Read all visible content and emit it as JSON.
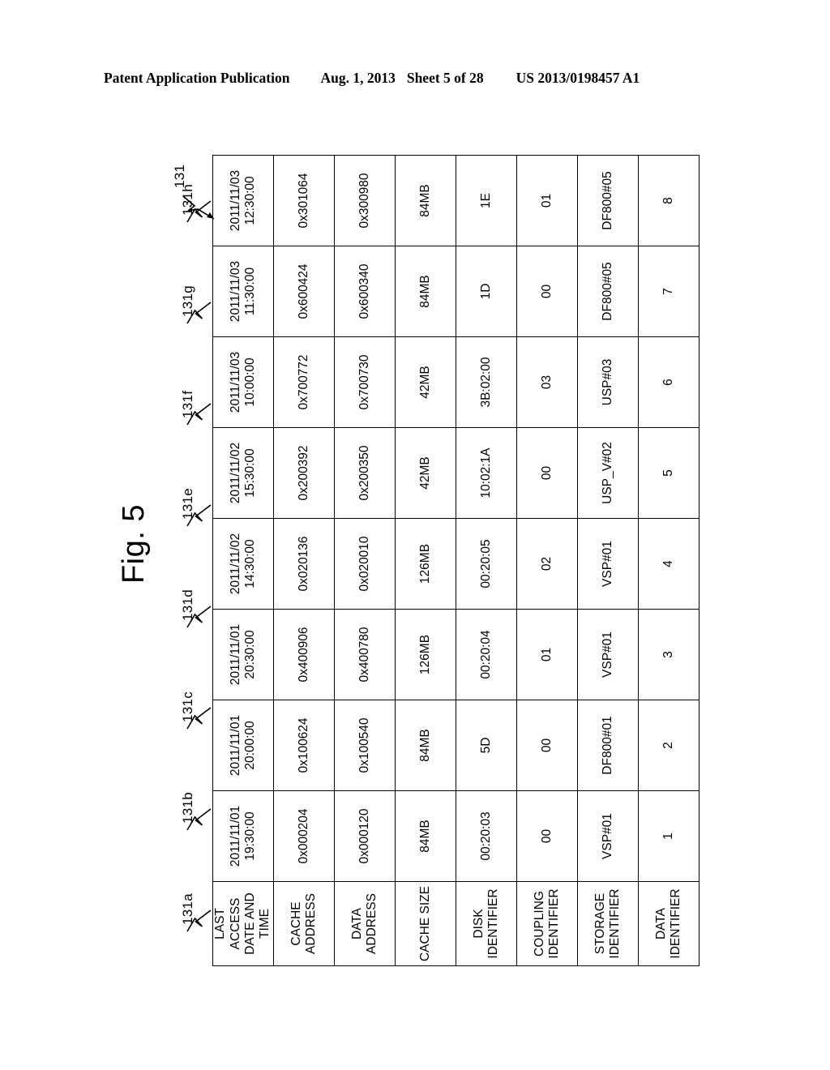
{
  "header": {
    "publication": "Patent Application Publication",
    "date": "Aug. 1, 2013",
    "sheet": "Sheet 5 of 28",
    "patent_number": "US 2013/0198457 A1"
  },
  "figure": {
    "title": "Fig. 5",
    "table_reference": "131"
  },
  "table": {
    "columns": [
      {
        "ref": "131a",
        "label": "DATA\nIDENTIFIER"
      },
      {
        "ref": "131b",
        "label": "STORAGE\nIDENTIFIER"
      },
      {
        "ref": "131c",
        "label": "COUPLING\nIDENTIFIER"
      },
      {
        "ref": "131d",
        "label": "DISK\nIDENTIFIER"
      },
      {
        "ref": "131e",
        "label": "CACHE SIZE"
      },
      {
        "ref": "131f",
        "label": "DATA\nADDRESS"
      },
      {
        "ref": "131g",
        "label": "CACHE\nADDRESS"
      },
      {
        "ref": "131h",
        "label": "LAST ACCESS\nDATE AND\nTIME"
      }
    ],
    "rows": [
      {
        "data_identifier": "1",
        "storage_identifier": "VSP#01",
        "coupling_identifier": "00",
        "disk_identifier": "00:20:03",
        "cache_size": "84MB",
        "data_address": "0x000120",
        "cache_address": "0x000204",
        "last_access": "2011/11/01\n19:30:00"
      },
      {
        "data_identifier": "2",
        "storage_identifier": "DF800#01",
        "coupling_identifier": "00",
        "disk_identifier": "5D",
        "cache_size": "84MB",
        "data_address": "0x100540",
        "cache_address": "0x100624",
        "last_access": "2011/11/01\n20:00:00"
      },
      {
        "data_identifier": "3",
        "storage_identifier": "VSP#01",
        "coupling_identifier": "01",
        "disk_identifier": "00:20:04",
        "cache_size": "126MB",
        "data_address": "0x400780",
        "cache_address": "0x400906",
        "last_access": "2011/11/01\n20:30:00"
      },
      {
        "data_identifier": "4",
        "storage_identifier": "VSP#01",
        "coupling_identifier": "02",
        "disk_identifier": "00:20:05",
        "cache_size": "126MB",
        "data_address": "0x020010",
        "cache_address": "0x020136",
        "last_access": "2011/11/02\n14:30:00"
      },
      {
        "data_identifier": "5",
        "storage_identifier": "USP_V#02",
        "coupling_identifier": "00",
        "disk_identifier": "10:02:1A",
        "cache_size": "42MB",
        "data_address": "0x200350",
        "cache_address": "0x200392",
        "last_access": "2011/11/02\n15:30:00"
      },
      {
        "data_identifier": "6",
        "storage_identifier": "USP#03",
        "coupling_identifier": "03",
        "disk_identifier": "3B:02:00",
        "cache_size": "42MB",
        "data_address": "0x700730",
        "cache_address": "0x700772",
        "last_access": "2011/11/03\n10:00:00"
      },
      {
        "data_identifier": "7",
        "storage_identifier": "DF800#05",
        "coupling_identifier": "00",
        "disk_identifier": "1D",
        "cache_size": "84MB",
        "data_address": "0x600340",
        "cache_address": "0x600424",
        "last_access": "2011/11/03\n11:30:00"
      },
      {
        "data_identifier": "8",
        "storage_identifier": "DF800#05",
        "coupling_identifier": "01",
        "disk_identifier": "1E",
        "cache_size": "84MB",
        "data_address": "0x300980",
        "cache_address": "0x301064",
        "last_access": "2011/11/03\n12:30:00"
      }
    ]
  },
  "colors": {
    "ink": "#000000",
    "paper": "#ffffff"
  }
}
